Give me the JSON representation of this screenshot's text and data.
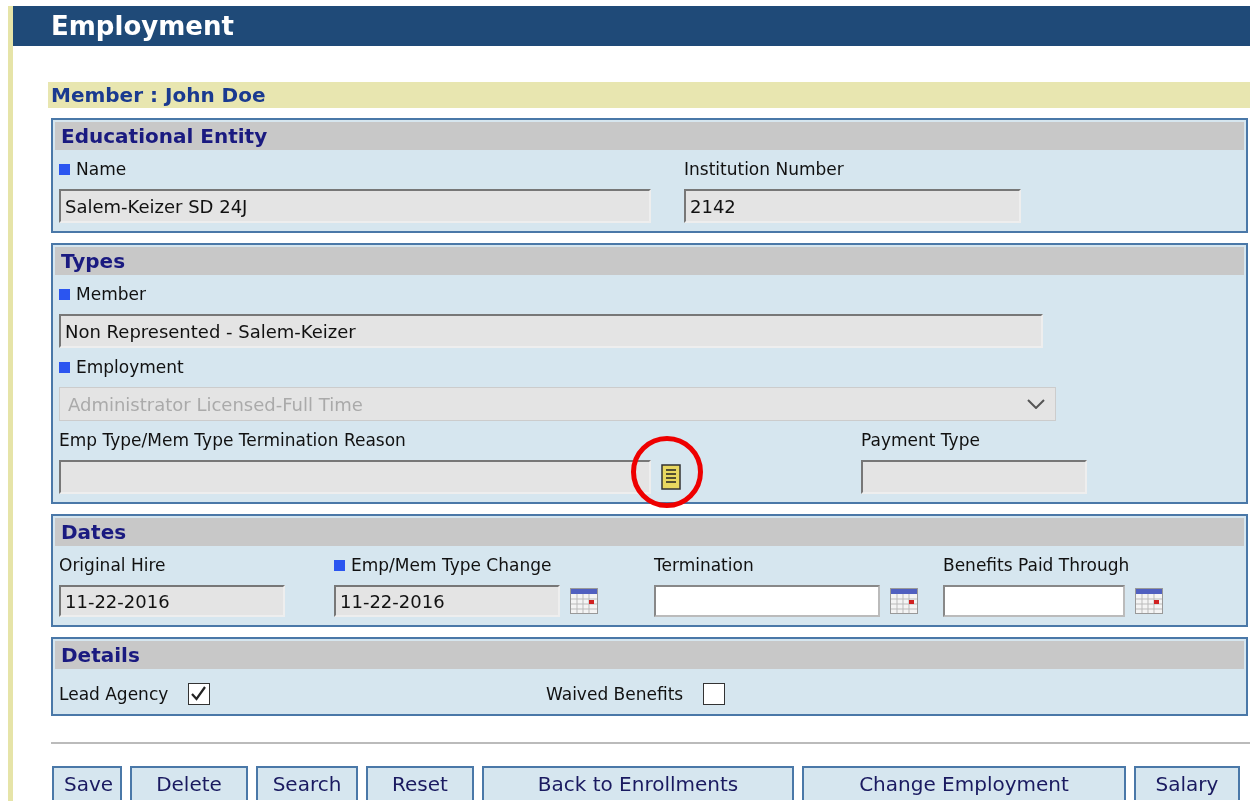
{
  "page_title": "Employment",
  "member_label": "Member : John Doe",
  "sections": [
    {
      "title": "Educational Entity",
      "rows": [
        [
          {
            "kind": "text",
            "label": "Name",
            "required": true,
            "value": "Salem-Keizer SD 24J",
            "readonly": true
          },
          {
            "kind": "text",
            "label": "Institution Number",
            "required": false,
            "value": "2142",
            "readonly": true
          }
        ]
      ]
    },
    {
      "title": "Types",
      "rows": [
        [
          {
            "kind": "text",
            "label": "Member",
            "required": true,
            "value": "Non Represented - Salem-Keizer",
            "readonly": true
          }
        ],
        [
          {
            "kind": "select",
            "label": "Employment",
            "required": true,
            "value": "Administrator Licensed-Full Time",
            "disabled": true
          }
        ],
        [
          {
            "kind": "lookup",
            "label": "Emp Type/Mem Type Termination Reason",
            "required": false,
            "readonly": true,
            "highlighted": true
          },
          {
            "kind": "text",
            "label": "Payment Type",
            "required": false,
            "readonly": true
          }
        ]
      ]
    },
    {
      "title": "Dates",
      "rows": [
        [
          {
            "kind": "text",
            "label": "Original Hire",
            "required": false,
            "value": "11-22-2016",
            "readonly": true
          },
          {
            "kind": "date",
            "label": "Emp/Mem Type Change",
            "required": true,
            "value": "11-22-2016",
            "readonly": true
          },
          {
            "kind": "date",
            "label": "Termination",
            "required": false,
            "readonly": false
          },
          {
            "kind": "date",
            "label": "Benefits Paid Through",
            "required": false,
            "readonly": false
          }
        ]
      ]
    },
    {
      "title": "Details",
      "rows": [
        [
          {
            "kind": "checkbox",
            "label": "Lead Agency",
            "checked": true
          },
          {
            "kind": "checkbox",
            "label": "Waived Benefits",
            "checked": false
          }
        ]
      ]
    }
  ],
  "buttons": [
    "Save",
    "Delete",
    "Search",
    "Reset",
    "Back to Enrollments",
    "Change Employment",
    "Salary"
  ]
}
